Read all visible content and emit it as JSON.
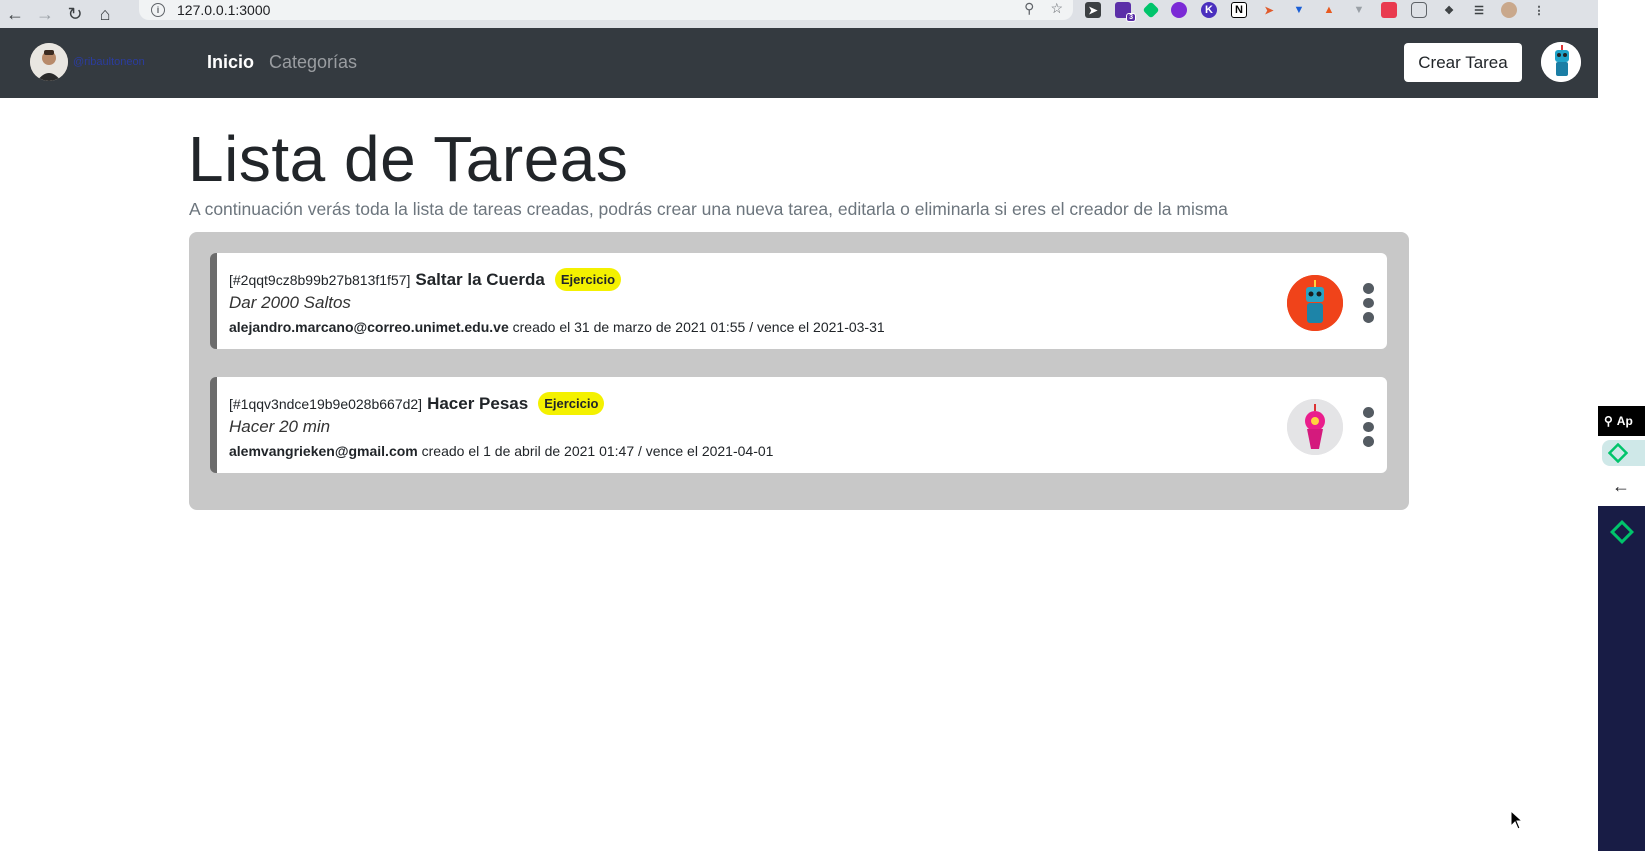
{
  "browser": {
    "url": "127.0.0.1:3000",
    "extension_badge": "3"
  },
  "navbar": {
    "username": "@ribaultoneon",
    "links": [
      "Inicio",
      "Categorías"
    ],
    "create_button": "Crear Tarea"
  },
  "page": {
    "title": "Lista de Tareas",
    "subtitle": "A continuación verás toda la lista de tareas creadas, podrás crear una nueva tarea, editarla o eliminarla si eres el creador de la misma"
  },
  "tasks": [
    {
      "id": "[#2qqt9cz8b99b27b813f1f57]",
      "title": "Saltar la Cuerda",
      "category": "Ejercicio",
      "description": "Dar 2000 Saltos",
      "author": "alejandro.marcano@correo.unimet.edu.ve",
      "meta": "creado el 31 de marzo de 2021 01:55 / vence el 2021-03-31",
      "avatar_color": "#f0431a"
    },
    {
      "id": "[#1qqv3ndce19b9e028b667d2]",
      "title": "Hacer Pesas",
      "category": "Ejercicio",
      "description": "Hacer 20 min",
      "author": "alemvangrieken@gmail.com",
      "meta": "creado el 1 de abril de 2021 01:47 / vence el 2021-04-01",
      "avatar_color": "#e4e4e6"
    }
  ],
  "side_panel": {
    "search_label": "Ap"
  },
  "colors": {
    "navbar": "#343a40",
    "badge": "#f4f100",
    "container": "#c8c8c8"
  }
}
